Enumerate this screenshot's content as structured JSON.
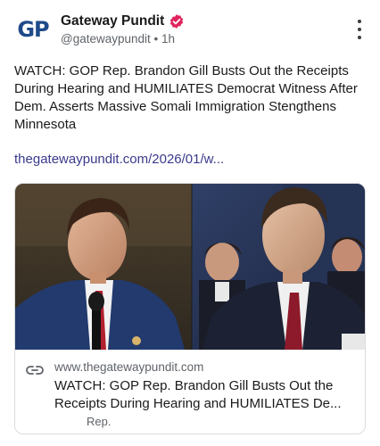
{
  "post": {
    "author_name": "Gateway Pundit",
    "author_handle": "@gatewaypundit",
    "separator": "•",
    "time": "1h",
    "avatar_text_g": "G",
    "avatar_text_p": "P",
    "text": "WATCH: GOP Rep. Brandon Gill Busts Out the Receipts During Hearing and HUMILIATES Democrat Witness After Dem. Asserts Massive Somali Immigration Stengthens Minnesota",
    "link": "thegatewaypundit.com/2026/01/w..."
  },
  "card": {
    "domain": "www.thegatewaypundit.com",
    "title_line1": "WATCH: GOP Rep. Brandon Gill Busts Out the",
    "title_line2": "Receipts During Hearing and HUMILIATES De...",
    "subtext": "Rep."
  },
  "icons": {
    "avatar": "gateway-pundit-logo",
    "verified": "verified-badge-icon",
    "menu": "more-vertical-icon",
    "link": "link-icon"
  },
  "colors": {
    "verified": "#e0245e",
    "link_text": "#3a3a8c",
    "muted": "#5f6368",
    "logo_blue": "#1f4a8a"
  }
}
